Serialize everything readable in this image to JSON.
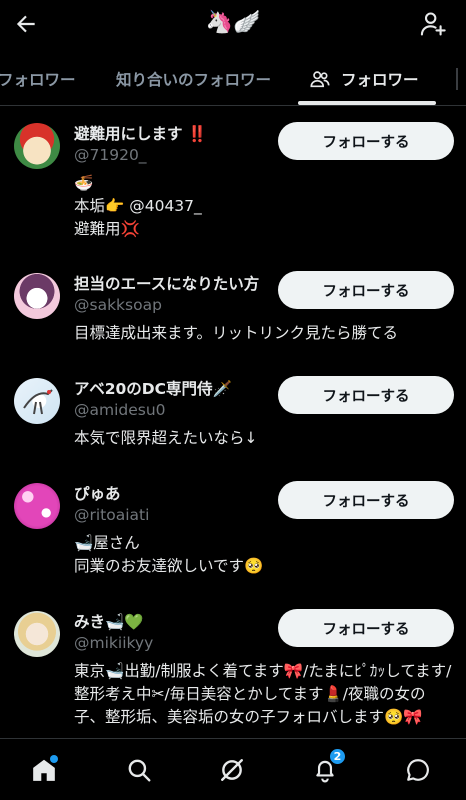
{
  "header": {
    "title": "🦄🪽"
  },
  "tabs": [
    {
      "label": "フォロワー"
    },
    {
      "label": "知り合いのフォロワー"
    },
    {
      "label": "フォロワー"
    }
  ],
  "users": [
    {
      "name": "避難用にします",
      "handle": "@71920_",
      "bio": [
        "🍜",
        "本垢👉 @40437_",
        "避難用💢"
      ],
      "follow_label": "フォローする"
    },
    {
      "name": "担当のエースになりたい方",
      "handle": "@sakksoap",
      "bio": [
        "目標達成出来ます。リットリンク見たら勝てる"
      ],
      "follow_label": "フォローする"
    },
    {
      "name": "アベ20のDC専門侍🗡️",
      "handle": "@amidesu0",
      "bio": [
        "本気で限界超えたいなら↓"
      ],
      "follow_label": "フォローする"
    },
    {
      "name": "ぴゅあ",
      "handle": "@ritoaiati",
      "bio": [
        "🛁屋さん",
        "同業のお友達欲しいです🥺"
      ],
      "follow_label": "フォローする"
    },
    {
      "name": "みき🛁💚",
      "handle": "@mikiikyy",
      "bio": [
        "東京🛁出勤/制服よく着てます🎀/たまにﾋﾟｶｯしてます/整形考え中✂︎/毎日美容とかしてます💄/夜職の女の子、整形垢、美容垢の女の子フォロバします🥺🎀"
      ],
      "follow_label": "フォローする"
    }
  ],
  "nav": {
    "notifications_count": "2"
  },
  "colors": {
    "background": "#000000",
    "accent": "#1d9bf0",
    "button_bg": "#eff3f4",
    "secondary_text": "#71767b"
  }
}
